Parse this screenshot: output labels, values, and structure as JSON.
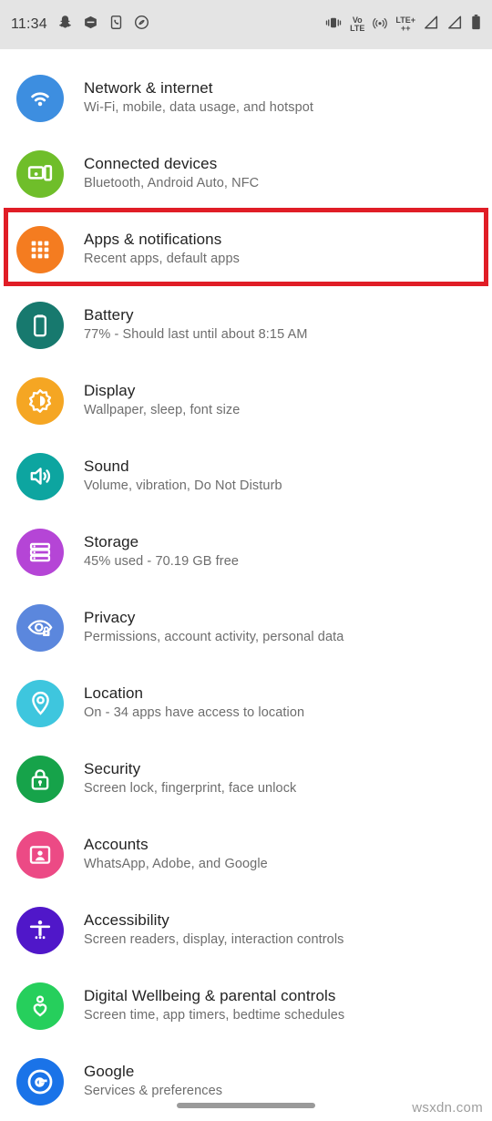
{
  "statusbar": {
    "time": "11:34",
    "left_icons": [
      "snapchat-icon",
      "hexagon-app-icon",
      "phone-app-icon",
      "shazam-icon"
    ],
    "right_icons": [
      "vibrate-icon",
      "volte-icon",
      "hotspot-icon",
      "lte-plus-icon",
      "signal-sim1-icon",
      "signal-sim2-icon",
      "battery-icon"
    ],
    "volte_label_top": "VoLTE",
    "volte_line1": "Vo",
    "volte_line2": "LTE",
    "lte_line1": "LTE+",
    "lte_line2": "++",
    "background": "#e4e4e4"
  },
  "highlight": {
    "target": "Apps & notifications",
    "color": "#e01d26",
    "border_width": "5px"
  },
  "settings": {
    "items": [
      {
        "title": "Network & internet",
        "subtitle": "Wi-Fi, mobile, data usage, and hotspot",
        "icon": "wifi-icon",
        "color": "#3d8ee0",
        "name": "setting-network-internet"
      },
      {
        "title": "Connected devices",
        "subtitle": "Bluetooth, Android Auto, NFC",
        "icon": "connected-devices-icon",
        "color": "#6fbe2a",
        "name": "setting-connected-devices"
      },
      {
        "title": "Apps & notifications",
        "subtitle": "Recent apps, default apps",
        "icon": "apps-grid-icon",
        "color": "#f47c20",
        "name": "setting-apps-notifications"
      },
      {
        "title": "Battery",
        "subtitle": "77% - Should last until about 8:15 AM",
        "icon": "battery-icon",
        "color": "#17796e",
        "name": "setting-battery"
      },
      {
        "title": "Display",
        "subtitle": "Wallpaper, sleep, font size",
        "icon": "brightness-icon",
        "color": "#f5a623",
        "name": "setting-display"
      },
      {
        "title": "Sound",
        "subtitle": "Volume, vibration, Do Not Disturb",
        "icon": "volume-icon",
        "color": "#0da5a0",
        "name": "setting-sound"
      },
      {
        "title": "Storage",
        "subtitle": "45% used - 70.19 GB free",
        "icon": "storage-icon",
        "color": "#b545d6",
        "name": "setting-storage"
      },
      {
        "title": "Privacy",
        "subtitle": "Permissions, account activity, personal data",
        "icon": "privacy-eye-lock-icon",
        "color": "#5b87dd",
        "name": "setting-privacy"
      },
      {
        "title": "Location",
        "subtitle": "On - 34 apps have access to location",
        "icon": "location-pin-icon",
        "color": "#3ec6de",
        "name": "setting-location"
      },
      {
        "title": "Security",
        "subtitle": "Screen lock, fingerprint, face unlock",
        "icon": "lock-icon",
        "color": "#16a34a",
        "name": "setting-security"
      },
      {
        "title": "Accounts",
        "subtitle": "WhatsApp, Adobe, and Google",
        "icon": "account-card-icon",
        "color": "#ec4a85",
        "name": "setting-accounts"
      },
      {
        "title": "Accessibility",
        "subtitle": "Screen readers, display, interaction controls",
        "icon": "accessibility-icon",
        "color": "#5017c9",
        "name": "setting-accessibility"
      },
      {
        "title": "Digital Wellbeing & parental controls",
        "subtitle": "Screen time, app timers, bedtime schedules",
        "icon": "wellbeing-heart-icon",
        "color": "#26cf5c",
        "name": "setting-digital-wellbeing"
      },
      {
        "title": "Google",
        "subtitle": "Services & preferences",
        "icon": "google-g-icon",
        "color": "#1a73e8",
        "name": "setting-google"
      }
    ]
  },
  "footer": {
    "watermark": "wsxdn.com",
    "gesture_bar": "home-gesture-bar"
  }
}
